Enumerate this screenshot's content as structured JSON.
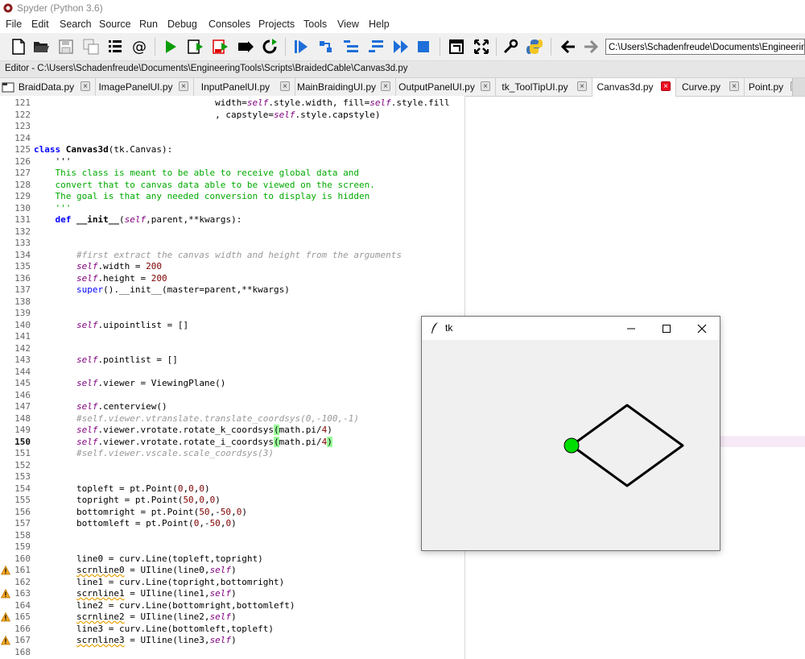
{
  "window": {
    "title": "Spyder (Python 3.6)"
  },
  "menu": [
    "File",
    "Edit",
    "Search",
    "Source",
    "Run",
    "Debug",
    "Consoles",
    "Projects",
    "Tools",
    "View",
    "Help"
  ],
  "toolbar": {
    "path": "C:\\Users\\Schadenfreude\\Documents\\EngineeringToo",
    "icons": [
      "new-file-icon",
      "open-folder-icon",
      "save-icon",
      "save-all-icon",
      "file-list-icon",
      "at-icon",
      "run-icon",
      "run-cell-icon",
      "run-cell-advance-icon",
      "run-selection-icon",
      "rerun-icon",
      "debug-icon",
      "step-icon",
      "step-into-icon",
      "step-return-icon",
      "continue-icon",
      "stop-icon",
      "maximize-pane-icon",
      "fullscreen-icon",
      "preferences-icon",
      "python-icon",
      "back-arrow-icon",
      "forward-arrow-icon"
    ]
  },
  "editor": {
    "title": "Editor - C:\\Users\\Schadenfreude\\Documents\\EngineeringTools\\Scripts\\BraidedCable\\Canvas3d.py",
    "tabs": [
      "BraidData.py",
      "ImagePanelUI.py",
      "InputPanelUI.py",
      "MainBraidingUI.py",
      "OutputPanelUI.py",
      "tk_ToolTipUI.py",
      "Canvas3d.py",
      "Curve.py",
      "Point.py"
    ],
    "active_tab": "Canvas3d.py",
    "current_line": 150,
    "warning_lines": [
      161,
      163,
      165,
      167
    ],
    "line_numbers": [
      "121",
      "122",
      "123",
      "124",
      "125",
      "126",
      "127",
      "128",
      "129",
      "130",
      "131",
      "132",
      "133",
      "134",
      "135",
      "136",
      "137",
      "138",
      "139",
      "140",
      "141",
      "142",
      "143",
      "144",
      "145",
      "146",
      "147",
      "148",
      "149",
      "150",
      "151",
      "152",
      "153",
      "154",
      "155",
      "156",
      "157",
      "158",
      "159",
      "160",
      "161",
      "162",
      "163",
      "164",
      "165",
      "166",
      "167",
      "168"
    ],
    "code_lines": [
      "                                  width=self.style.width, fill=self.style.fill",
      "                                  , capstyle=self.style.capstyle)",
      "",
      "",
      "class Canvas3d(tk.Canvas):",
      "    '''",
      "    This class is meant to be able to receive global data and",
      "    convert that to canvas data able to be viewed on the screen.",
      "    The goal is that any needed conversion to display is hidden",
      "    '''",
      "    def __init__(self,parent,**kwargs):",
      "",
      "",
      "        #first extract the canvas width and height from the arguments",
      "        self.width = 200",
      "        self.height = 200",
      "        super().__init__(master=parent,**kwargs)",
      "",
      "",
      "        self.uipointlist = []",
      "",
      "",
      "        self.pointlist = []",
      "",
      "        self.viewer = ViewingPlane()",
      "",
      "        self.centerview()",
      "        #self.viewer.vtranslate.translate_coordsys(0,-100,-1)",
      "        self.viewer.vrotate.rotate_k_coordsys(math.pi/4)",
      "        self.viewer.vrotate.rotate_i_coordsys(math.pi/4)",
      "        #self.viewer.vscale.scale_coordsys(3)",
      "",
      "",
      "        topleft = pt.Point(0,0,0)",
      "        topright = pt.Point(50,0,0)",
      "        bottomright = pt.Point(50,-50,0)",
      "        bottomleft = pt.Point(0,-50,0)",
      "",
      "",
      "        line0 = curv.Line(topleft,topright)",
      "        scrnline0 = UIline(line0,self)",
      "        line1 = curv.Line(topright,bottomright)",
      "        scrnline1 = UIline(line1,self)",
      "        line2 = curv.Line(bottomright,bottomleft)",
      "        scrnline2 = UIline(line2,self)",
      "        line3 = curv.Line(bottomleft,topleft)",
      "        scrnline3 = UIline(line3,self)",
      ""
    ]
  },
  "tk_window": {
    "title": "tk",
    "shape_color": "#000000",
    "point_color": "#00dd00"
  }
}
